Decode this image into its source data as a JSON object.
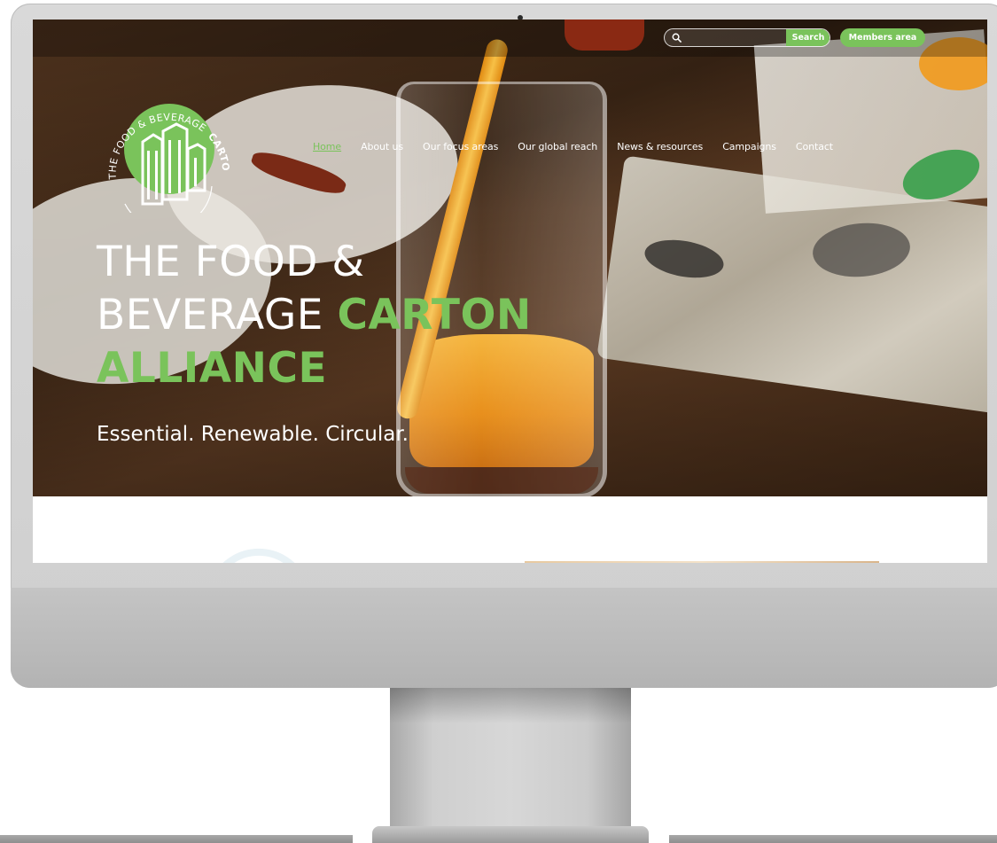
{
  "header": {
    "search": {
      "placeholder": "",
      "button_label": "Search",
      "icon": "search-icon"
    },
    "members_label": "Members area"
  },
  "logo": {
    "arc_text_part1": "THE FOOD & BEVERAGE",
    "arc_text_part2": "CARTON ALLIANCE"
  },
  "nav": {
    "items": [
      {
        "label": "Home",
        "active": true
      },
      {
        "label": "About us",
        "active": false
      },
      {
        "label": "Our focus areas",
        "active": false
      },
      {
        "label": "Our global reach",
        "active": false
      },
      {
        "label": "News & resources",
        "active": false
      },
      {
        "label": "Campaigns",
        "active": false
      },
      {
        "label": "Contact",
        "active": false
      }
    ]
  },
  "hero": {
    "line1": "THE FOOD &",
    "line2_white": "BEVERAGE ",
    "line2_green": "CARTON",
    "line3_green": "ALLIANCE",
    "tagline": "Essential. Renewable. Circular."
  },
  "colors": {
    "brand_green": "#7ac35b",
    "white": "#ffffff"
  }
}
